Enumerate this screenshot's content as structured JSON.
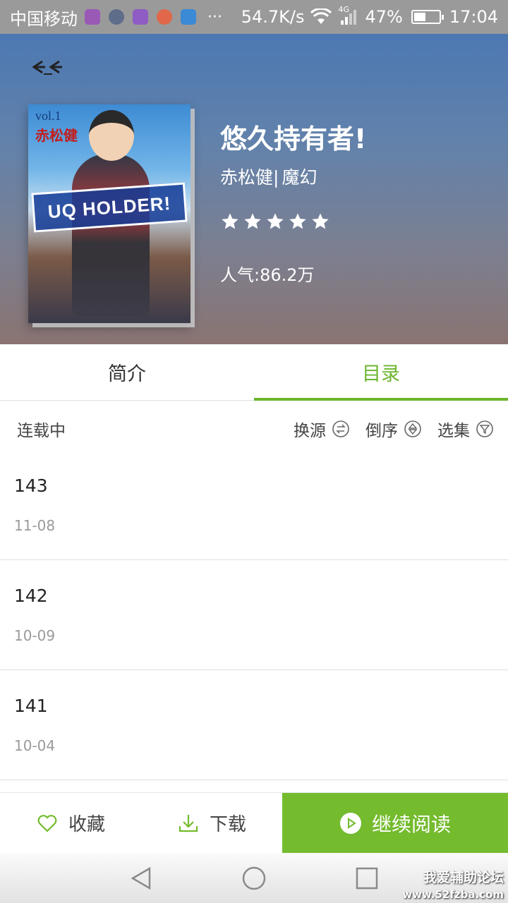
{
  "status_bar": {
    "carrier": "中国移动",
    "speed": "54.7K/s",
    "network": "4G",
    "battery": "47%",
    "battery_level": 0.47,
    "time": "17:04",
    "dots": "···"
  },
  "book": {
    "title": "悠久持有者!",
    "author": "赤松健|",
    "genre": "魔幻",
    "rating_stars": 5,
    "popularity_label": "人气:",
    "popularity_value": "86.2万",
    "cover": {
      "vol": "vol.1",
      "author": "赤松健",
      "logo": "UQ HOLDER!"
    }
  },
  "tabs": [
    {
      "label": "简介",
      "active": false
    },
    {
      "label": "目录",
      "active": true
    }
  ],
  "toolbar": {
    "status": "连载中",
    "switch_source": "换源",
    "reverse": "倒序",
    "select": "选集"
  },
  "chapters": [
    {
      "number": "143",
      "date": "11-08"
    },
    {
      "number": "142",
      "date": "10-09"
    },
    {
      "number": "141",
      "date": "10-04"
    }
  ],
  "actions": {
    "favorite": "收藏",
    "download": "下载",
    "continue": "继续阅读"
  },
  "watermark": {
    "name": "我爱辅助论坛",
    "url": "www.52fzba.com"
  },
  "colors": {
    "accent": "#74bb2e",
    "hero_top": "#4c78b2",
    "hero_bottom": "#8a7472"
  }
}
